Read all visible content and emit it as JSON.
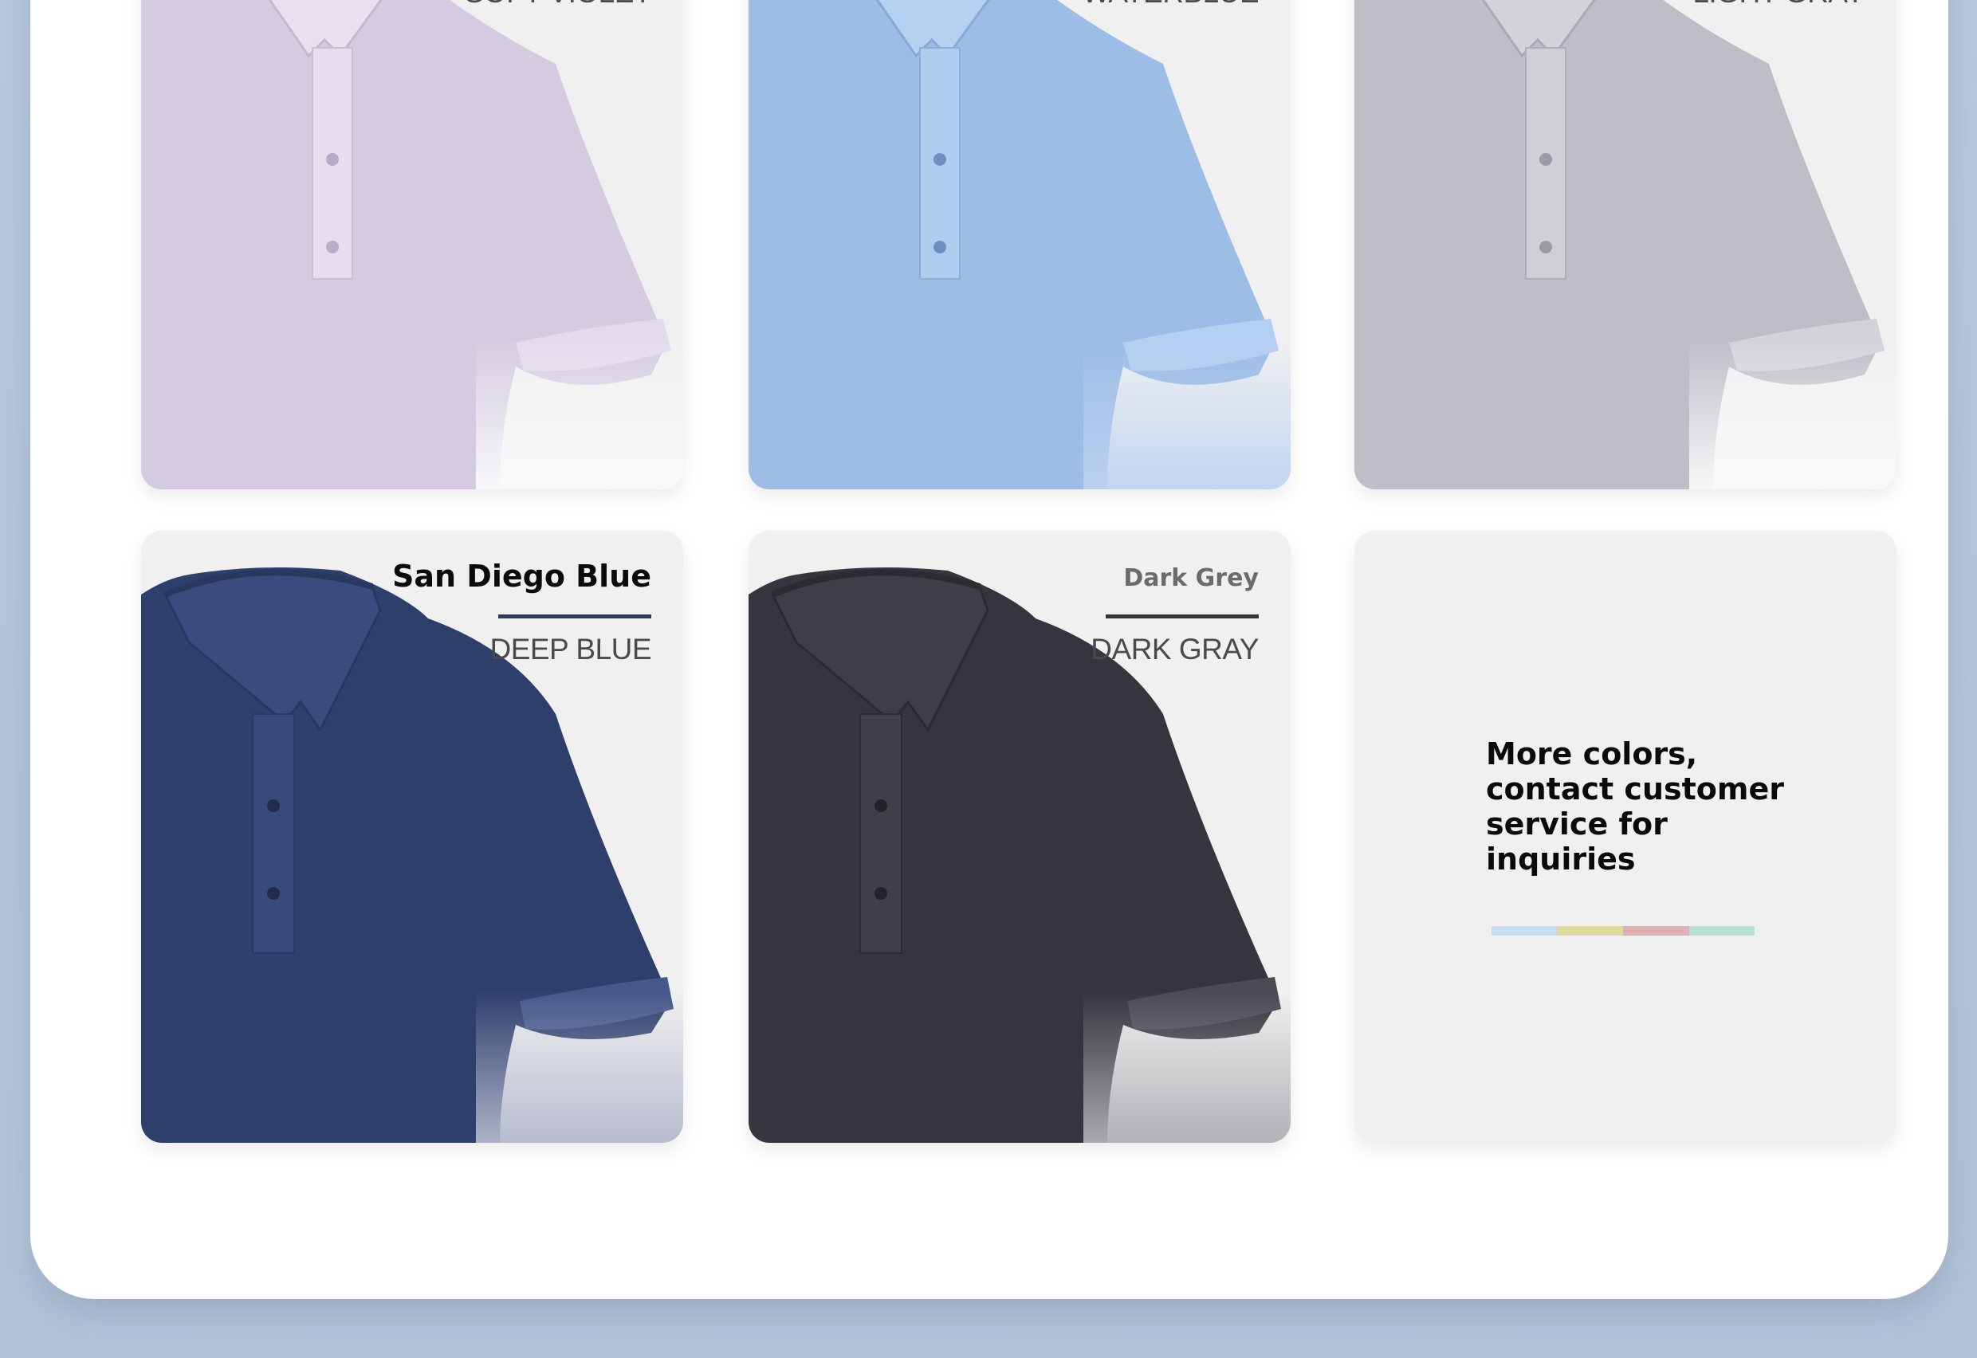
{
  "colors": {
    "background": "#b6c5d9",
    "panel": "#ffffff",
    "card": "#f0f0f1"
  },
  "row1": [
    {
      "code": "SOFT VIOLET",
      "shirt_color": "#d4cbe0",
      "accent_color": "#9a9aa5"
    },
    {
      "code": "WATERBLUE",
      "shirt_color": "#9dbde6",
      "accent_color": "#7d9fcf"
    },
    {
      "code": "LIGHT GRAY",
      "shirt_color": "#bdbec6",
      "accent_color": "#9c9da3"
    }
  ],
  "row2": [
    {
      "name": "San Diego Blue",
      "code": "DEEP BLUE",
      "shirt_color": "#2f3f6c",
      "accent_color": "#2c3a5e"
    },
    {
      "name": "Dark Grey",
      "code": "DARK GRAY",
      "shirt_color": "#35353d",
      "accent_color": "#333338"
    }
  ],
  "more_colors": {
    "text": "More colors, contact customer service for inquiries",
    "swatches": [
      "#c8dcef",
      "#e0da9c",
      "#dcb1b8",
      "#b8e3d0"
    ]
  }
}
